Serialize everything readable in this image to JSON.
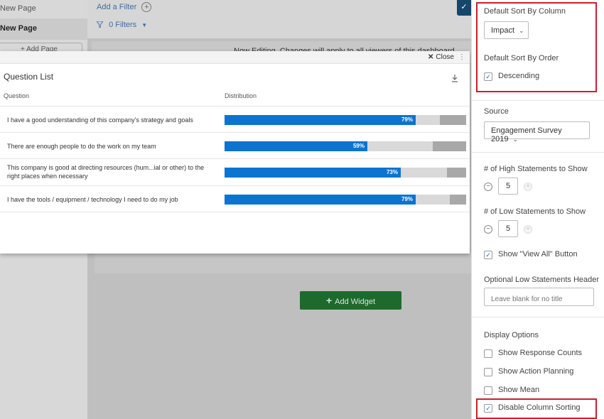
{
  "nav": {
    "pages": [
      "New Page",
      "New Page"
    ],
    "add_page": "+ Add Page"
  },
  "toolbar": {
    "add_filter": "Add a Filter",
    "add_filter_icon": "+",
    "filters": "0 Filters",
    "filter_icon": "funnel-icon",
    "check_icon": "✓"
  },
  "banner": {
    "text": "Now Editing. Changes will apply to all viewers of this dashboard"
  },
  "add_widget": "Add Widget",
  "modal": {
    "close": "Close",
    "title": "Question List",
    "columns": {
      "question": "Question",
      "distribution": "Distribution"
    },
    "rows": [
      {
        "question": "I have a good understanding of this company's strategy and goals",
        "pct": 79,
        "label": "79%",
        "mid": 0.1,
        "dark": 0.11
      },
      {
        "question": "There are enough people to do the work on my team",
        "pct": 59,
        "label": "59%",
        "mid": 0.27,
        "dark": 0.14
      },
      {
        "question": "This company is good at directing resources (hum...ial or other) to the right places when necessary",
        "pct": 73,
        "label": "73%",
        "mid": 0.19,
        "dark": 0.08
      },
      {
        "question": "I have the tools / equipment / technology I need to do my job",
        "pct": 79,
        "label": "79%",
        "mid": 0.14,
        "dark": 0.07
      }
    ]
  },
  "panel": {
    "sort_column_label": "Default Sort By Column",
    "sort_column_value": "Impact",
    "sort_order_label": "Default Sort By Order",
    "descending": "Descending",
    "source_label": "Source",
    "source_value": "Engagement Survey 2019",
    "high_label": "# of High Statements to Show",
    "high_value": "5",
    "low_label": "# of Low Statements to Show",
    "low_value": "5",
    "view_all": "Show \"View All\" Button",
    "low_header_label": "Optional Low Statements Header",
    "low_header_placeholder": "Leave blank for no title",
    "display_options": "Display Options",
    "opt_response_counts": "Show Response Counts",
    "opt_action_planning": "Show Action Planning",
    "opt_mean": "Show Mean",
    "opt_disable_sorting": "Disable Column Sorting"
  },
  "colors": {
    "accent": "#0b74d0",
    "highlight": "#c8202d",
    "add_widget": "#1e6a2c"
  }
}
